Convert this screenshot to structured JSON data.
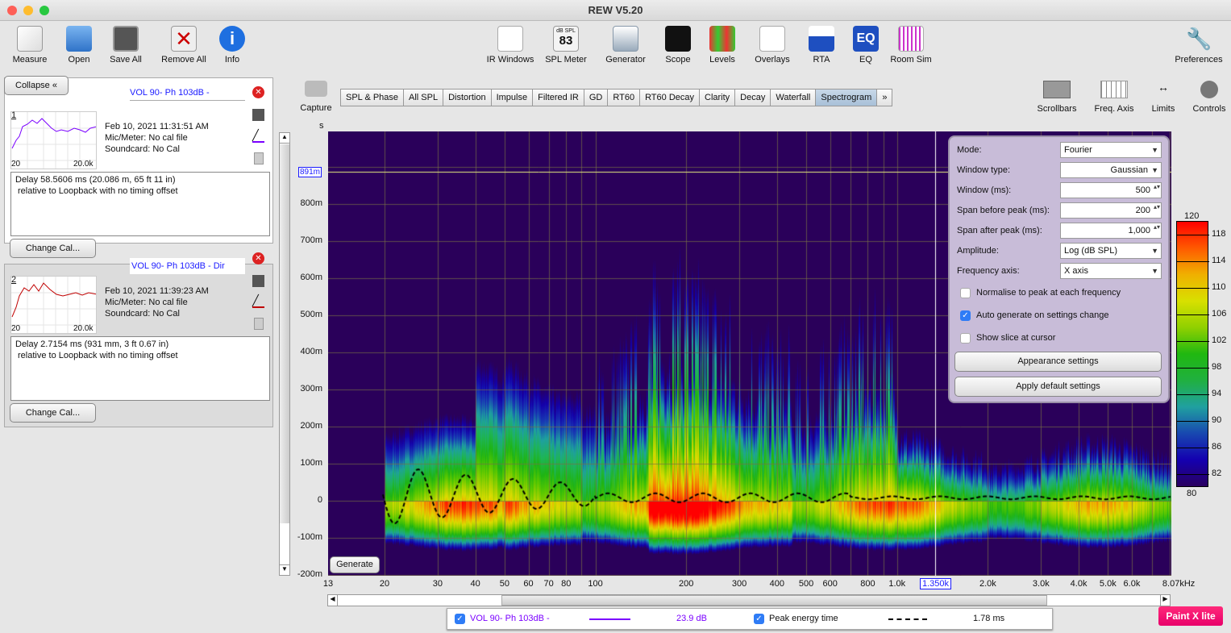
{
  "window": {
    "title": "REW V5.20"
  },
  "toolbar": {
    "left": [
      {
        "label": "Measure",
        "icon": "measure-icon"
      },
      {
        "label": "Open",
        "icon": "folder-icon"
      },
      {
        "label": "Save All",
        "icon": "save-icon"
      },
      {
        "label": "Remove All",
        "icon": "remove-icon"
      },
      {
        "label": "Info",
        "icon": "info-icon"
      }
    ],
    "center": [
      {
        "label": "IR Windows",
        "icon": "ir-windows-icon"
      },
      {
        "label": "SPL Meter",
        "icon": "spl-meter-icon",
        "readout_top": "dB SPL",
        "readout": "83"
      },
      {
        "label": "Generator",
        "icon": "generator-icon"
      },
      {
        "label": "Scope",
        "icon": "scope-icon"
      },
      {
        "label": "Levels",
        "icon": "levels-icon"
      },
      {
        "label": "Overlays",
        "icon": "overlays-icon"
      },
      {
        "label": "RTA",
        "icon": "rta-icon"
      },
      {
        "label": "EQ",
        "icon": "eq-icon"
      },
      {
        "label": "Room Sim",
        "icon": "room-sim-icon"
      }
    ],
    "preferences": "Preferences"
  },
  "sidebar": {
    "collapse": "Collapse",
    "measurements": [
      {
        "num": "1",
        "name": "VOL 90- Ph 103dB -",
        "date": "Feb 10, 2021 11:31:51 AM",
        "mic": "Mic/Meter: No cal file",
        "soundcard": "Soundcard: No Cal",
        "fmin": "20",
        "fmax": "20.0k",
        "delay": "Delay 58.5606 ms (20.086 m, 65 ft 11 in)",
        "relative": "relative to Loopback with no timing offset",
        "change_cal": "Change Cal...",
        "color": "#7a00ff"
      },
      {
        "num": "2",
        "name": "VOL 90- Ph 103dB - Dir",
        "date": "Feb 10, 2021 11:39:23 AM",
        "mic": "Mic/Meter: No cal file",
        "soundcard": "Soundcard: No Cal",
        "fmin": "20",
        "fmax": "20.0k",
        "delay": "Delay 2.7154 ms (931 mm, 3 ft 0.67 in)",
        "relative": "relative to Loopback with no timing offset",
        "change_cal": "Change Cal...",
        "color": "#c00000"
      }
    ]
  },
  "capture": "Capture",
  "tabs": [
    {
      "label": "SPL & Phase"
    },
    {
      "label": "All SPL"
    },
    {
      "label": "Distortion"
    },
    {
      "label": "Impulse"
    },
    {
      "label": "Filtered IR"
    },
    {
      "label": "GD"
    },
    {
      "label": "RT60"
    },
    {
      "label": "RT60 Decay"
    },
    {
      "label": "Clarity"
    },
    {
      "label": "Decay"
    },
    {
      "label": "Waterfall"
    },
    {
      "label": "Spectrogram",
      "active": true
    },
    {
      "label": "»"
    }
  ],
  "right_tools": [
    {
      "label": "Scrollbars"
    },
    {
      "label": "Freq. Axis"
    },
    {
      "label": "Limits"
    },
    {
      "label": "Controls"
    }
  ],
  "plot": {
    "y_unit": "s",
    "y_ticks": [
      "800m",
      "700m",
      "600m",
      "500m",
      "400m",
      "300m",
      "200m",
      "100m",
      "0",
      "-100m",
      "-200m"
    ],
    "y_cursor": "891m",
    "x_ticks": [
      "13",
      "20",
      "30",
      "40",
      "50",
      "60",
      "70",
      "80",
      "100",
      "200",
      "300",
      "400",
      "500",
      "600",
      "800",
      "1.0k",
      "2.0k",
      "3.0k",
      "4.0k",
      "5.0k",
      "6.0k",
      "8.07kHz"
    ],
    "x_cursor": "1.350k",
    "generate": "Generate"
  },
  "controls": {
    "mode_label": "Mode:",
    "mode": "Fourier",
    "window_type_label": "Window type:",
    "window_type": "Gaussian",
    "window_label": "Window (ms):",
    "window": "500",
    "span_before_label": "Span before peak (ms):",
    "span_before": "200",
    "span_after_label": "Span after peak (ms):",
    "span_after": "1,000",
    "amplitude_label": "Amplitude:",
    "amplitude": "Log (dB SPL)",
    "freq_axis_label": "Frequency axis:",
    "freq_axis": "X axis",
    "normalise": {
      "label": "Normalise to peak at each frequency",
      "checked": false
    },
    "auto_generate": {
      "label": "Auto generate on settings change",
      "checked": true
    },
    "show_slice": {
      "label": "Show slice at cursor",
      "checked": false
    },
    "appearance": "Appearance settings",
    "defaults": "Apply default settings"
  },
  "colorbar": {
    "max": "120",
    "min": "80",
    "ticks": [
      "118",
      "114",
      "110",
      "106",
      "102",
      "98",
      "94",
      "90",
      "86",
      "82"
    ]
  },
  "legend": {
    "series": "VOL 90- Ph 103dB -",
    "series_value": "23.9 dB",
    "series_color": "#7a00ff",
    "peak": "Peak energy time",
    "peak_value": "1.78 ms"
  },
  "badge": "Paint X lite"
}
